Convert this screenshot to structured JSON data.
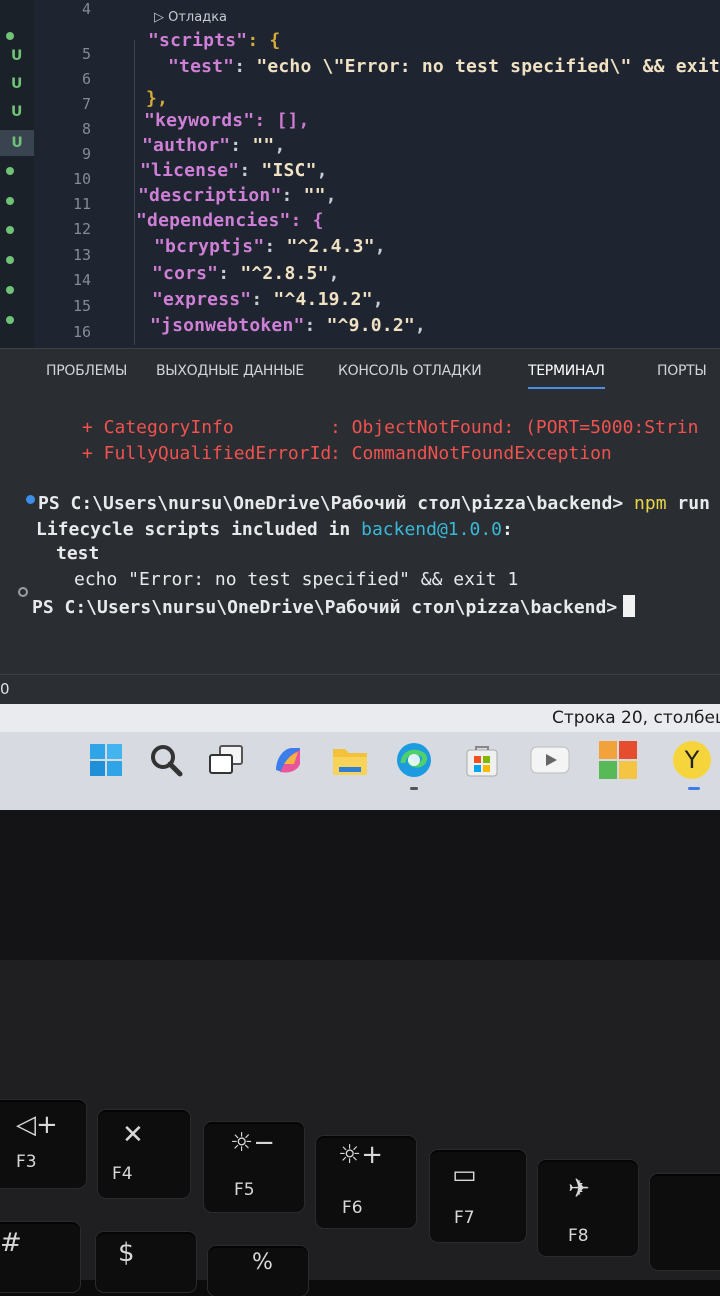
{
  "editor": {
    "debug_lens": "▷ Отладка",
    "git_marks": [
      "U",
      "U",
      "U",
      "U"
    ],
    "line_numbers": [
      "4",
      "5",
      "6",
      "7",
      "8",
      "9",
      "10",
      "11",
      "12",
      "13",
      "14",
      "15",
      "16"
    ],
    "lines": {
      "l5_key": "\"scripts\"",
      "l5_rest": ": {",
      "l6_key": "\"test\"",
      "l6_colon": ": ",
      "l6_val": "\"echo \\\"Error: no test specified\\\" && exit",
      "l7": "},",
      "l8_key": "\"keywords\"",
      "l8_rest": ": [],",
      "l9_key": "\"author\"",
      "l9_colon": ": ",
      "l9_val": "\"\"",
      "l9_end": ",",
      "l10_key": "\"license\"",
      "l10_colon": ": ",
      "l10_val": "\"ISC\"",
      "l10_end": ",",
      "l11_key": "\"description\"",
      "l11_colon": ": ",
      "l11_val": "\"\"",
      "l11_end": ",",
      "l12_key": "\"dependencies\"",
      "l12_rest": ": {",
      "l13_key": "\"bcryptjs\"",
      "l13_colon": ": ",
      "l13_val": "\"^2.4.3\"",
      "l13_end": ",",
      "l14_key": "\"cors\"",
      "l14_colon": ": ",
      "l14_val": "\"^2.8.5\"",
      "l14_end": ",",
      "l15_key": "\"express\"",
      "l15_colon": ": ",
      "l15_val": "\"^4.19.2\"",
      "l15_end": ",",
      "l16_key": "\"jsonwebtoken\"",
      "l16_colon": ": ",
      "l16_val": "\"^9.0.2\"",
      "l16_end": ","
    }
  },
  "panel": {
    "tabs": [
      "ПРОБЛЕМЫ",
      "ВЫХОДНЫЕ ДАННЫЕ",
      "КОНСОЛЬ ОТЛАДКИ",
      "ТЕРМИНАЛ",
      "ПОРТЫ"
    ],
    "active_tab": "ТЕРМИНАЛ"
  },
  "terminal": {
    "err1_label": "+ CategoryInfo",
    "err1_value": ": ObjectNotFound: (PORT=5000:Strin",
    "err2_label": "+ FullyQualifiedErrorId",
    "err2_value": ": CommandNotFoundException",
    "prompt1": "PS C:\\Users\\nursu\\OneDrive\\Рабочий стол\\pizza\\backend>",
    "cmd1_npm": "npm",
    "cmd1_rest": "run",
    "lifecycle_prefix": "Lifecycle scripts included in ",
    "lifecycle_pkg": "backend@1.0.0",
    "lifecycle_suffix": ":",
    "script_name": "test",
    "script_cmd": "echo \"Error: no test specified\" && exit 1",
    "prompt2": "PS C:\\Users\\nursu\\OneDrive\\Рабочий стол\\pizza\\backend>"
  },
  "status": {
    "left": "0",
    "right": "Строка 20, столбец"
  },
  "taskbar": {
    "icons": [
      "windows-start-icon",
      "search-icon",
      "task-view-icon",
      "copilot-icon",
      "file-explorer-icon",
      "edge-icon",
      "store-icon",
      "youtube-icon",
      "microsoft-office-icon",
      "yandex-browser-icon"
    ]
  },
  "keyboard": {
    "keys": [
      {
        "icon": "◁+",
        "label": "F3"
      },
      {
        "icon": "✕",
        "label": "F4"
      },
      {
        "icon": "☼−",
        "label": "F5"
      },
      {
        "icon": "☼+",
        "label": "F6"
      },
      {
        "icon": "▭",
        "label": "F7"
      },
      {
        "icon": "✈",
        "label": "F8"
      }
    ],
    "lower_left": "#",
    "lower_mid": "$",
    "lower_right": "%"
  },
  "colors": {
    "editor_bg": "#1e2530",
    "terminal_bg": "#2a2d31",
    "json_key": "#cf7fd6",
    "error_text": "#f0524f",
    "accent_tab": "#4c8de6"
  }
}
